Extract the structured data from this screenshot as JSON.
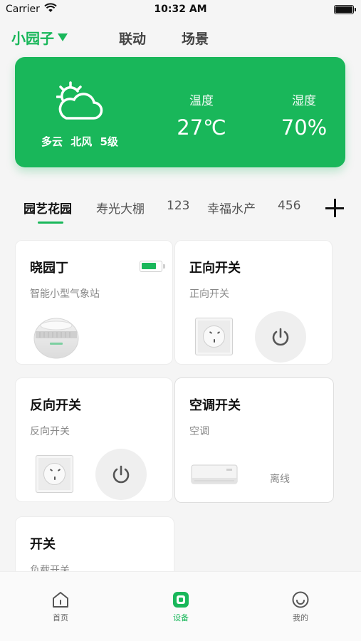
{
  "status_bar": {
    "carrier": "Carrier",
    "time": "10:32 AM"
  },
  "top_nav": {
    "home_name": "小园子",
    "tab_link": "联动",
    "tab_scene": "场景"
  },
  "weather": {
    "description": "多云",
    "wind_direction": "北风",
    "wind_level": "5级",
    "temperature_label": "温度",
    "temperature_value": "27℃",
    "humidity_label": "湿度",
    "humidity_value": "70%"
  },
  "rooms": [
    "园艺花园",
    "寿光大棚",
    "123",
    "幸福水产",
    "456"
  ],
  "active_room": "园艺花园",
  "devices": [
    {
      "name": "晓园丁",
      "type": "智能小型气象站",
      "icon": "weather-station-icon",
      "battery": 0.85
    },
    {
      "name": "正向开关",
      "type": "正向开关",
      "icon": "socket-icon"
    },
    {
      "name": "反向开关",
      "type": "反向开关",
      "icon": "socket-icon"
    },
    {
      "name": "空调开关",
      "type": "空调",
      "icon": "air-conditioner-icon",
      "status": "离线"
    },
    {
      "name": "开关",
      "type": "负载开关"
    }
  ],
  "tab_bar": {
    "home": "首页",
    "device": "设备",
    "mine": "我的",
    "active": "设备"
  },
  "colors": {
    "accent": "#19b75a",
    "background": "#f5f5f5"
  }
}
